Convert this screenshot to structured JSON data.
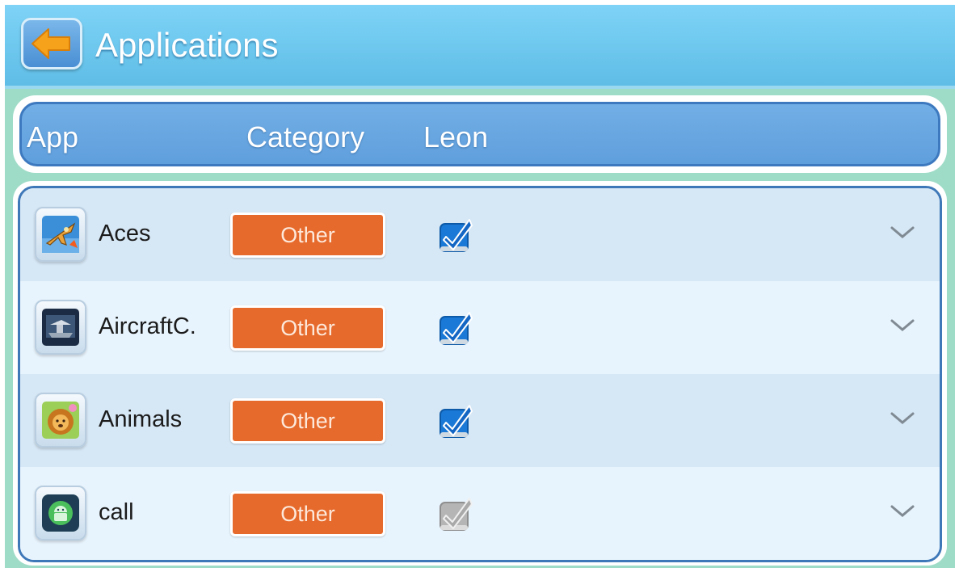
{
  "header": {
    "title": "Applications"
  },
  "table": {
    "columns": [
      "App",
      "Category",
      "Leon"
    ]
  },
  "apps": [
    {
      "name": "Aces",
      "category": "Other",
      "leon_checked": true,
      "icon": "fighter-jet-icon"
    },
    {
      "name": "AircraftC.",
      "category": "Other",
      "leon_checked": true,
      "icon": "aircraft-carrier-icon"
    },
    {
      "name": "Animals",
      "category": "Other",
      "leon_checked": true,
      "icon": "lion-icon"
    },
    {
      "name": "call",
      "category": "Other",
      "leon_checked": false,
      "icon": "android-call-icon"
    }
  ],
  "colors": {
    "titlebar": "#6cc8f0",
    "header_bar": "#69a7e2",
    "category_button": "#e66a2c",
    "checkbox_checked": "#1f7fd9",
    "checkbox_unchecked": "#b3b3b3"
  }
}
